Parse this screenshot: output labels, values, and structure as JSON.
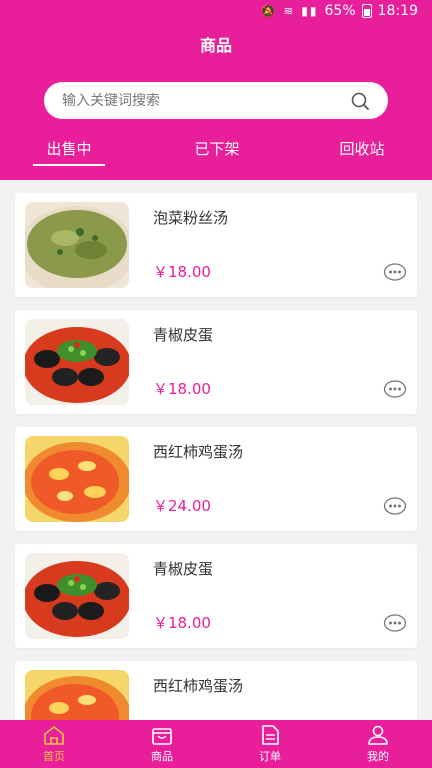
{
  "status_bar": {
    "battery": "65%",
    "time": "18:19",
    "icons": [
      "mute-icon",
      "wifi-icon",
      "signal-icon",
      "battery-icon"
    ]
  },
  "header": {
    "title": "商品",
    "search_placeholder": "输入关键词搜索",
    "tabs": [
      {
        "label": "出售中",
        "active": true
      },
      {
        "label": "已下架",
        "active": false
      },
      {
        "label": "回收站",
        "active": false
      }
    ]
  },
  "products": [
    {
      "name": "泡菜粉丝汤",
      "price": "￥18.00",
      "image": "pickled-vegetable-soup"
    },
    {
      "name": "青椒皮蛋",
      "price": "￥18.00",
      "image": "green-pepper-preserved-egg"
    },
    {
      "name": "西红柿鸡蛋汤",
      "price": "￥24.00",
      "image": "tomato-egg-soup"
    },
    {
      "name": "青椒皮蛋",
      "price": "￥18.00",
      "image": "green-pepper-preserved-egg"
    },
    {
      "name": "西红柿鸡蛋汤",
      "price": "",
      "image": "tomato-egg-soup"
    }
  ],
  "bottom_nav": [
    {
      "label": "首页",
      "icon": "home-icon",
      "active": true
    },
    {
      "label": "商品",
      "icon": "bag-icon",
      "active": false
    },
    {
      "label": "订单",
      "icon": "document-icon",
      "active": false
    },
    {
      "label": "我的",
      "icon": "user-icon",
      "active": false
    }
  ],
  "colors": {
    "accent": "#e91e9a",
    "active_nav": "#f5c542",
    "background": "#f2f2f2"
  }
}
